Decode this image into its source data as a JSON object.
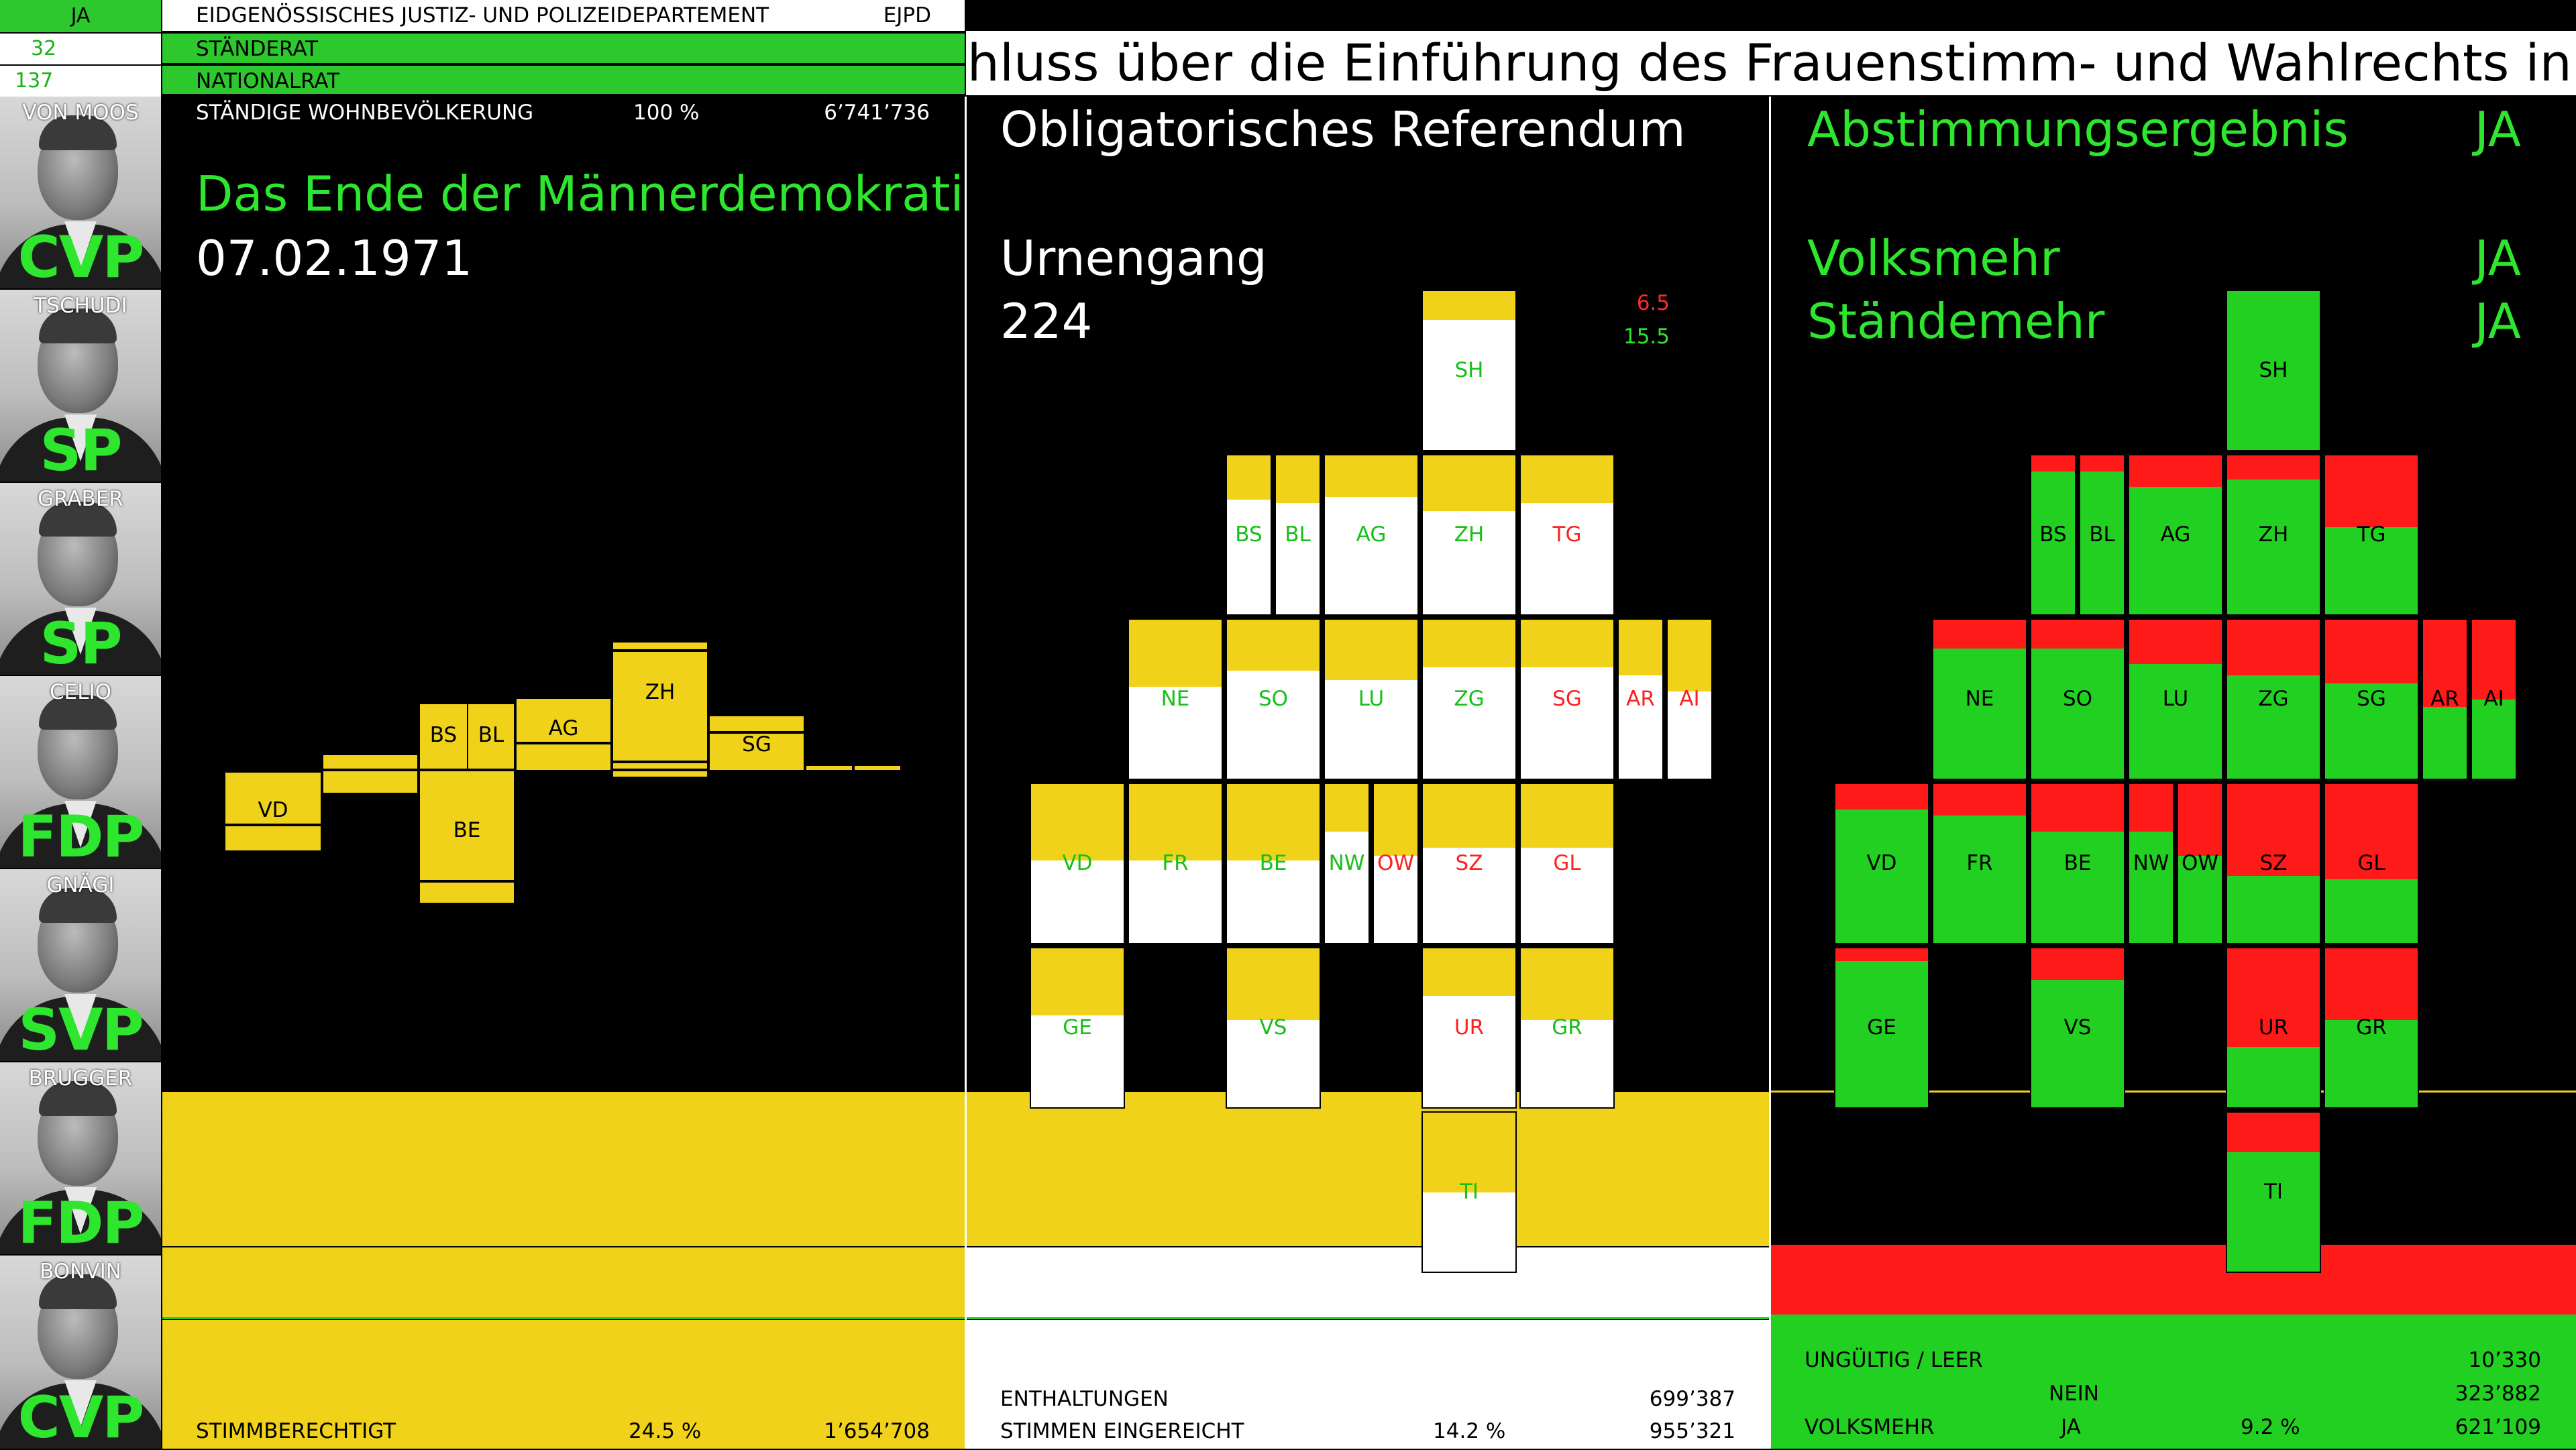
{
  "vote": {
    "result_label": "JA",
    "staenderat_count": "32",
    "nationalrat_count": "137"
  },
  "header": {
    "department": "EIDGENÖSSISCHES JUSTIZ- UND POLIZEIDEPARTEMENT",
    "department_short": "EJPD",
    "staenderat_label": "STÄNDERAT",
    "nationalrat_label": "NATIONALRAT",
    "ticker": "chluss über die Einführung des Frauenstimm- und Wahlrechts in eidge"
  },
  "councillors": [
    {
      "name": "VON MOOS",
      "party": "CVP"
    },
    {
      "name": "TSCHUDI",
      "party": "SP"
    },
    {
      "name": "GRABER",
      "party": "SP"
    },
    {
      "name": "CELIO",
      "party": "FDP"
    },
    {
      "name": "GNÄGI",
      "party": "SVP"
    },
    {
      "name": "BRUGGER",
      "party": "FDP"
    },
    {
      "name": "BONVIN",
      "party": "CVP"
    }
  ],
  "panel1": {
    "population_label": "STÄNDIGE WOHNBEVÖLKERUNG",
    "population_pct": "100 %",
    "population_value": "6’741’736",
    "title": "Das Ende der Männerdemokratie",
    "date": "07.02.1971",
    "eligible_label": "STIMMBERECHTIGT",
    "eligible_pct": "24.5 %",
    "eligible_value": "1’654’708",
    "canton_labels": {
      "VD": "VD",
      "BE": "BE",
      "BS": "BS",
      "BL": "BL",
      "AG": "AG",
      "ZH": "ZH",
      "SG": "SG"
    }
  },
  "panel2": {
    "title": "Obligatorisches Referendum",
    "subtitle": "Urnengang",
    "number": "224",
    "red_value": "6.5",
    "green_value": "15.5",
    "abstentions_label": "ENTHALTUNGEN",
    "abstentions_value": "699’387",
    "submitted_label": "STIMMEN EINGEREICHT",
    "submitted_pct": "14.2 %",
    "submitted_value": "955’321"
  },
  "panel3": {
    "title": "Abstimmungsergebnis",
    "title_result": "JA",
    "volksmehr": "Volksmehr",
    "volksmehr_result": "JA",
    "staendemehr": "Ständemehr",
    "staendemehr_result": "JA",
    "invalid_label": "UNGÜLTIG / LEER",
    "invalid_value": "10’330",
    "nein_label": "NEIN",
    "nein_value": "323’882",
    "volksmehr_label": "VOLKSMEHR",
    "ja_label": "JA",
    "ja_pct": "9.2 %",
    "ja_value": "621’109"
  },
  "cantons": [
    {
      "code": "SH",
      "result": "ja"
    },
    {
      "code": "BS",
      "result": "ja"
    },
    {
      "code": "BL",
      "result": "ja"
    },
    {
      "code": "AG",
      "result": "ja"
    },
    {
      "code": "ZH",
      "result": "ja"
    },
    {
      "code": "TG",
      "result": "nein"
    },
    {
      "code": "NE",
      "result": "ja"
    },
    {
      "code": "SO",
      "result": "ja"
    },
    {
      "code": "LU",
      "result": "ja"
    },
    {
      "code": "ZG",
      "result": "ja"
    },
    {
      "code": "SG",
      "result": "nein"
    },
    {
      "code": "AR",
      "result": "nein"
    },
    {
      "code": "AI",
      "result": "nein"
    },
    {
      "code": "VD",
      "result": "ja"
    },
    {
      "code": "FR",
      "result": "ja"
    },
    {
      "code": "BE",
      "result": "ja"
    },
    {
      "code": "NW",
      "result": "ja"
    },
    {
      "code": "OW",
      "result": "nein"
    },
    {
      "code": "SZ",
      "result": "nein"
    },
    {
      "code": "GL",
      "result": "nein"
    },
    {
      "code": "GE",
      "result": "ja"
    },
    {
      "code": "VS",
      "result": "ja"
    },
    {
      "code": "UR",
      "result": "nein"
    },
    {
      "code": "GR",
      "result": "ja"
    },
    {
      "code": "TI",
      "result": "ja"
    }
  ],
  "colors": {
    "yes": "#22d022",
    "no": "#ff1a1a",
    "eligible": "#f0d21a"
  }
}
